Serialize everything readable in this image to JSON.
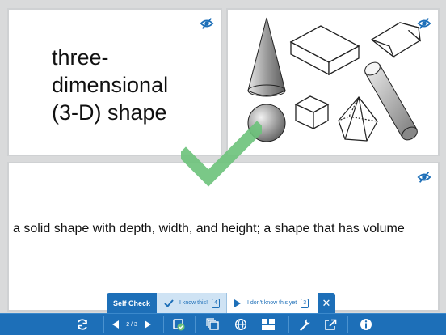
{
  "term_card": {
    "lines": [
      "three-",
      "dimensional",
      "(3-D) shape"
    ],
    "hide_icon": "eye-slash-icon"
  },
  "image_card": {
    "hide_icon": "eye-slash-icon",
    "image": "3-D shapes illustration"
  },
  "definition_card": {
    "text": "a solid shape with depth, width, and height; a shape that has volume",
    "hide_icon": "eye-slash-icon"
  },
  "self_check": {
    "title": "Self Check",
    "known_label": "I know this!",
    "known_count": "4",
    "unknown_label": "I don't know this yet",
    "unknown_count": "3",
    "close": "✕"
  },
  "toolbar": {
    "page_indicator": "2 / 3"
  },
  "colors": {
    "brand_blue": "#1d6fb8",
    "check_green": "#6cc27a"
  }
}
